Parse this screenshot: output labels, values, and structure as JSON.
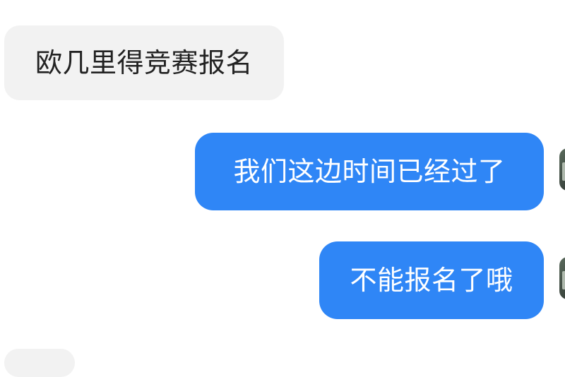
{
  "chat": {
    "messages": [
      {
        "side": "incoming",
        "text": "欧几里得竞赛报名"
      },
      {
        "side": "outgoing",
        "text": "我们这边时间已经过了"
      },
      {
        "side": "outgoing",
        "text": "不能报名了哦"
      },
      {
        "side": "incoming",
        "text": ""
      }
    ]
  },
  "colors": {
    "outgoing_bubble": "#2f86f6",
    "incoming_bubble": "#f2f2f2",
    "outgoing_text": "#ffffff",
    "incoming_text": "#222222",
    "background": "#ffffff"
  }
}
